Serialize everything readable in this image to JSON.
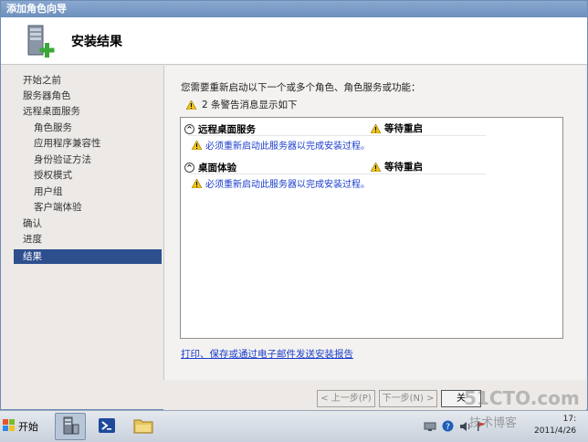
{
  "window": {
    "title": "添加角色向导"
  },
  "header": {
    "title": "安装结果"
  },
  "nav": {
    "items": [
      {
        "label": "开始之前",
        "sub": false
      },
      {
        "label": "服务器角色",
        "sub": false
      },
      {
        "label": "远程桌面服务",
        "sub": false
      },
      {
        "label": "角色服务",
        "sub": true
      },
      {
        "label": "应用程序兼容性",
        "sub": true
      },
      {
        "label": "身份验证方法",
        "sub": true
      },
      {
        "label": "授权模式",
        "sub": true
      },
      {
        "label": "用户组",
        "sub": true
      },
      {
        "label": "客户端体验",
        "sub": true
      },
      {
        "label": "确认",
        "sub": false
      },
      {
        "label": "进度",
        "sub": false
      },
      {
        "label": "结果",
        "sub": false,
        "active": true
      }
    ]
  },
  "content": {
    "intro": "您需要重新启动以下一个或多个角色、角色服务或功能：",
    "warning_summary": "2 条警告消息显示如下",
    "sections": [
      {
        "name": "远程桌面服务",
        "status": "等待重启",
        "message": "必须重新启动此服务器以完成安装过程。"
      },
      {
        "name": "桌面体验",
        "status": "等待重启",
        "message": "必须重新启动此服务器以完成安装过程。"
      }
    ],
    "report_link": "打印、保存或通过电子邮件发送安装报告"
  },
  "buttons": {
    "prev": "< 上一步(P)",
    "next": "下一步(N) >",
    "close": "关"
  },
  "taskbar": {
    "start_label": "开始",
    "clock_time": "17:",
    "clock_date": "2011/4/26"
  },
  "watermark": {
    "line1": "51CTO.com",
    "line2": "技术博客"
  },
  "colors": {
    "accent": "#2d4f8e",
    "link": "#1a3ccc",
    "warning": "#f0c419"
  }
}
